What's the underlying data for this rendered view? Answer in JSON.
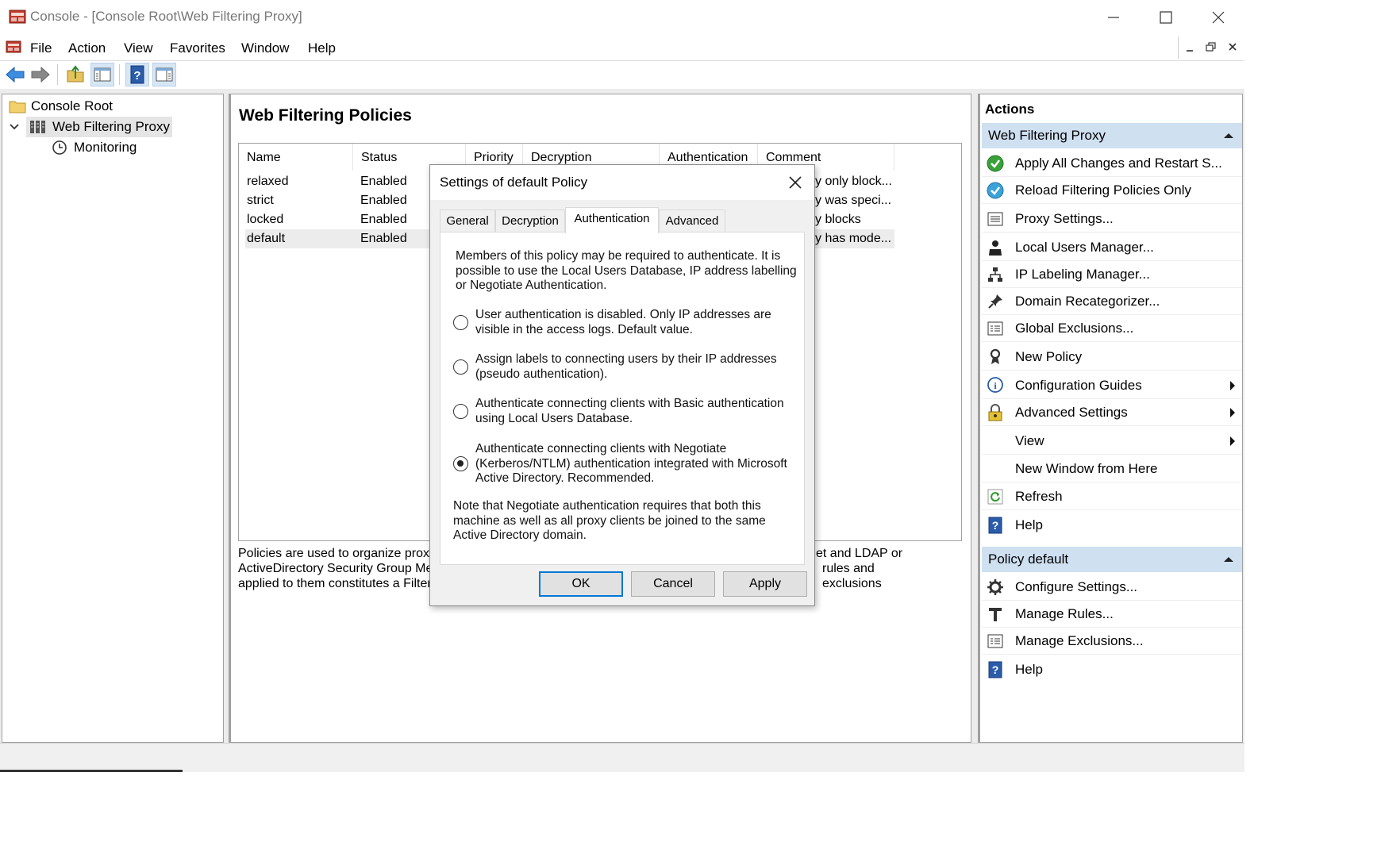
{
  "window": {
    "title": "Console - [Console Root\\Web Filtering Proxy]"
  },
  "menu": [
    "File",
    "Action",
    "View",
    "Favorites",
    "Window",
    "Help"
  ],
  "tree": {
    "root": "Console Root",
    "proxy": "Web Filtering Proxy",
    "monitoring": "Monitoring"
  },
  "center": {
    "heading": "Web Filtering Policies",
    "columns": [
      "Name",
      "Status",
      "Priority",
      "Decryption",
      "Authentication",
      "Comment"
    ],
    "rows": [
      {
        "name": "relaxed",
        "status": "Enabled",
        "comment": "y only block..."
      },
      {
        "name": "strict",
        "status": "Enabled",
        "comment": "y was speci..."
      },
      {
        "name": "locked",
        "status": "Enabled",
        "comment": "y blocks acc..."
      },
      {
        "name": "default",
        "status": "Enabled",
        "comment": "y has mode..."
      }
    ],
    "desc_left": [
      "Policies are used to organize proxy u",
      "ActiveDirectory Security Group Mem",
      "applied to them constitutes a Filterin"
    ],
    "desc_right": [
      "et and LDAP or",
      "rules and exclusions",
      ""
    ]
  },
  "actions": {
    "title": "Actions",
    "group1": "Web Filtering Proxy",
    "items1": [
      {
        "label": "Apply All Changes and Restart S...",
        "icon": "apply-check-icon"
      },
      {
        "label": "Reload Filtering Policies Only",
        "icon": "reload-check-icon"
      },
      {
        "label": "Proxy Settings...",
        "icon": "settings-list-icon"
      },
      {
        "label": "Local Users Manager...",
        "icon": "user-icon"
      },
      {
        "label": "IP Labeling Manager...",
        "icon": "network-tree-icon"
      },
      {
        "label": "Domain Recategorizer...",
        "icon": "pin-icon"
      },
      {
        "label": "Global Exclusions...",
        "icon": "exclusions-icon"
      },
      {
        "label": "New Policy",
        "icon": "ribbon-icon"
      },
      {
        "label": "Configuration Guides",
        "icon": "info-icon"
      },
      {
        "label": "Advanced Settings",
        "icon": "lock-icon"
      },
      {
        "label": "View",
        "icon": ""
      },
      {
        "label": "New Window from Here",
        "icon": ""
      },
      {
        "label": "Refresh",
        "icon": "refresh-icon"
      },
      {
        "label": "Help",
        "icon": "help-icon"
      }
    ],
    "group2": "Policy default",
    "items2": [
      {
        "label": "Configure Settings...",
        "icon": "gear-icon"
      },
      {
        "label": "Manage Rules...",
        "icon": "rules-icon"
      },
      {
        "label": "Manage Exclusions...",
        "icon": "exclusions-icon"
      },
      {
        "label": "Help",
        "icon": "help-icon"
      }
    ]
  },
  "dialog": {
    "title": "Settings of default Policy",
    "tabs": [
      "General",
      "Decryption",
      "Authentication",
      "Advanced"
    ],
    "active_tab": "Authentication",
    "intro": [
      "Members of this policy may be required to authenticate. It is",
      "possible to use the Local Users Database, IP address labelling",
      "or Negotiate Authentication."
    ],
    "options": [
      {
        "lines": [
          "User authentication is disabled. Only IP addresses are",
          "visible in the access logs. Default value."
        ],
        "checked": false
      },
      {
        "lines": [
          "Assign labels to connecting users by their IP addresses",
          "(pseudo authentication)."
        ],
        "checked": false
      },
      {
        "lines": [
          "Authenticate connecting clients with Basic authentication",
          "using Local Users Database."
        ],
        "checked": false
      },
      {
        "lines": [
          "Authenticate connecting clients with Negotiate",
          "(Kerberos/NTLM) authentication integrated with Microsoft",
          "Active Directory. Recommended."
        ],
        "checked": true
      }
    ],
    "note": [
      "Note that Negotiate authentication requires that both this",
      "machine as well as all proxy clients be joined to the same",
      "Active Directory domain."
    ],
    "buttons": {
      "ok": "OK",
      "cancel": "Cancel",
      "apply": "Apply"
    }
  },
  "colors": {
    "accent": "#0078d7",
    "group_header": "#cfe0f1",
    "selection": "#ececec"
  }
}
